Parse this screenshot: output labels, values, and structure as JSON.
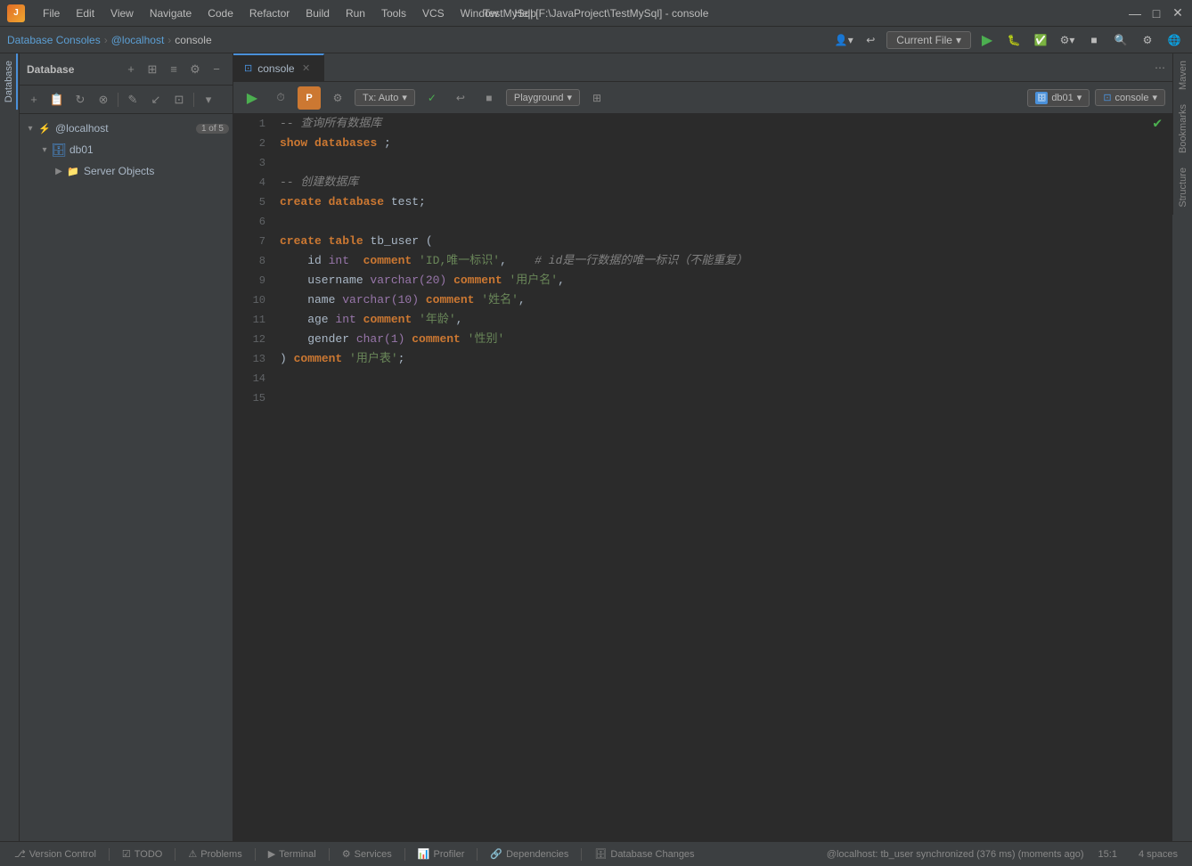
{
  "titlebar": {
    "app_name": "J",
    "title": "TestMySql [F:\\JavaProject\\TestMySql] - console",
    "menus": [
      "File",
      "Edit",
      "View",
      "Navigate",
      "Code",
      "Refactor",
      "Build",
      "Run",
      "Tools",
      "VCS",
      "Window",
      "Help"
    ],
    "minimize": "—",
    "maximize": "□",
    "close": "✕"
  },
  "navbar": {
    "breadcrumb": [
      "Database Consoles",
      "@localhost",
      "console"
    ],
    "current_file": "Current File",
    "dropdown_arrow": "▾"
  },
  "db_panel": {
    "title": "Database",
    "actions": [
      "+",
      "⊞",
      "≡",
      "⋯",
      "⚙",
      "−"
    ],
    "toolbar_icons": [
      "+",
      "📋",
      "↻",
      "⊗",
      "≡",
      "✎",
      "↙",
      "⊡",
      "▾"
    ],
    "tree": {
      "root": {
        "label": "@localhost",
        "badge": "1 of 5",
        "expanded": true,
        "icon": "🔌",
        "children": [
          {
            "label": "db01",
            "icon": "🗄",
            "expanded": true,
            "children": [
              {
                "label": "Server Objects",
                "icon": "📁",
                "expanded": false
              }
            ]
          }
        ]
      }
    }
  },
  "console": {
    "tab_label": "console",
    "tab_icon": "⊡",
    "toolbar": {
      "run": "▶",
      "history": "⏱",
      "p_btn": "P",
      "settings": "⚙",
      "tx_label": "Tx: Auto",
      "check": "✓",
      "rollback": "↩",
      "stop": "■",
      "playground": "Playground",
      "table_view": "⊞",
      "db_name": "db01",
      "console_name": "console"
    },
    "code": {
      "lines": [
        {
          "num": 1,
          "content": "cmt:-- 查询所有数据库",
          "check": false
        },
        {
          "num": 2,
          "content": "kw:show kw: databases fn: ;",
          "check": false
        },
        {
          "num": 3,
          "content": "",
          "check": false
        },
        {
          "num": 4,
          "content": "cmt:-- 创建数据库",
          "check": false
        },
        {
          "num": 5,
          "content": "kw:create kw: database fn: test;",
          "check": false
        },
        {
          "num": 6,
          "content": "",
          "check": false
        },
        {
          "num": 7,
          "content": "kw:create kw: table fn: tb_user (",
          "check": true
        },
        {
          "num": 8,
          "content": "  fn:id kw2: int fn:  kw:comment str:'ID,唯一标识',  cmt:# id是一行数据的唯一标识（不能重复）",
          "check": false
        },
        {
          "num": 9,
          "content": "  fn:username kw2:varchar(20) kw:comment str:'用户名',",
          "check": false
        },
        {
          "num": 10,
          "content": "  fn:name kw2:varchar(10) kw:comment str:'姓名',",
          "check": false
        },
        {
          "num": 11,
          "content": "  fn:age kw2:int kw:comment str:'年龄',",
          "check": false
        },
        {
          "num": 12,
          "content": "  fn:gender kw2:char(1) kw:comment str:'性别'",
          "check": false
        },
        {
          "num": 13,
          "content": "fn:) kw:comment str:'用户表';",
          "check": false
        },
        {
          "num": 14,
          "content": "",
          "check": false
        },
        {
          "num": 15,
          "content": "",
          "check": false
        }
      ],
      "ok_mark_line": 7
    }
  },
  "status_bar": {
    "items": [
      "Version Control",
      "TODO",
      "Problems",
      "Terminal",
      "Services",
      "Profiler",
      "Dependencies",
      "Database Changes"
    ],
    "message": "@localhost: tb_user synchronized (376 ms) (moments ago)",
    "position": "15:1",
    "indent": "4 spaces"
  },
  "side_panels": {
    "left": "Database",
    "right_top": "Maven",
    "right_bottom1": "Bookmarks",
    "right_bottom2": "Structure"
  }
}
